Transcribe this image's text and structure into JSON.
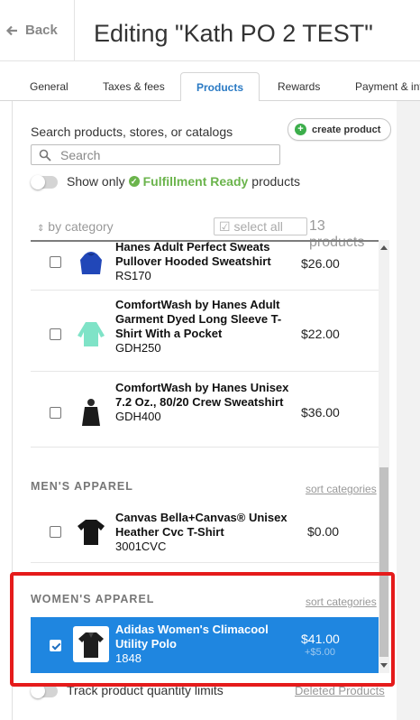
{
  "header": {
    "back_label": "Back",
    "title": "Editing \"Kath PO 2 TEST\""
  },
  "tabs": [
    {
      "label": "General"
    },
    {
      "label": "Taxes & fees"
    },
    {
      "label": "Products",
      "active": true
    },
    {
      "label": "Rewards"
    },
    {
      "label": "Payment & info"
    }
  ],
  "search": {
    "label": "Search products, stores, or catalogs",
    "placeholder": "Search",
    "value": ""
  },
  "create_product_label": "create product",
  "fulfillment_filter": {
    "prefix": "Show only",
    "highlight": "Fulfillment Ready",
    "suffix": "products",
    "enabled": false
  },
  "list_toolbar": {
    "sort_label": "by category",
    "select_all_label": "select all",
    "count_label": "13 products"
  },
  "products_top": [
    {
      "name": "Hanes Adult Perfect Sweats Pullover Hooded Sweatshirt",
      "sku": "RS170",
      "price": "$26.00",
      "checked": false,
      "image": "blue-hoodie"
    },
    {
      "name": "ComfortWash by Hanes Adult Garment Dyed Long Sleeve T-Shirt With a Pocket",
      "sku": "GDH250",
      "price": "$22.00",
      "checked": false,
      "image": "mint-long-sleeve"
    },
    {
      "name": "ComfortWash by Hanes Unisex 7.2 Oz., 80/20 Crew Sweatshirt",
      "sku": "GDH400",
      "price": "$36.00",
      "checked": false,
      "image": "black-crew"
    }
  ],
  "categories": [
    {
      "title": "MEN'S APPAREL",
      "sort_label": "sort categories",
      "products": [
        {
          "name": "Canvas Bella+Canvas® Unisex Heather Cvc T-Shirt",
          "sku": "3001CVC",
          "price": "$0.00",
          "checked": false,
          "image": "black-tshirt"
        }
      ]
    },
    {
      "title": "WOMEN'S APPAREL",
      "sort_label": "sort categories",
      "products": [
        {
          "name": "Adidas Women's Climacool Utility Polo",
          "sku": "1848",
          "price": "$41.00",
          "price_extra": "+$5.00",
          "checked": true,
          "image": "black-polo"
        }
      ]
    }
  ],
  "bottom": {
    "track_label": "Track product quantity limits",
    "deleted_label": "Deleted Products"
  },
  "colors": {
    "accent_blue": "#1f86e0",
    "fulfillment_green": "#6bb44c",
    "highlight_red": "#e51b1b"
  }
}
